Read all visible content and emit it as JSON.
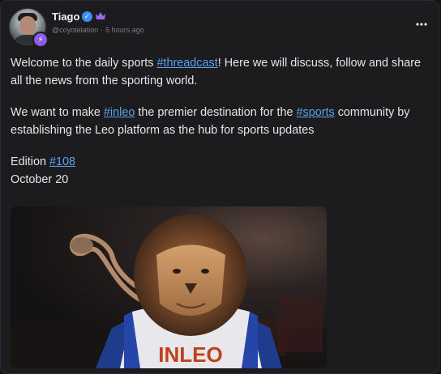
{
  "post": {
    "author_name": "Tiago",
    "handle": "@coyotelation",
    "separator": "·",
    "time_ago": "5 hours ago",
    "more_icon": "more-horizontal-icon",
    "p1": {
      "before": "Welcome to the daily sports ",
      "tag": "#threadcast",
      "after": "! Here we will discuss, follow and share all the news from the sporting world."
    },
    "p2": {
      "before": "We want to make ",
      "tag1": "#inleo",
      "middle": " the premier destination for the ",
      "tag2": "#sports",
      "after": " community by establishing the Leo platform as the hub for sports updates"
    },
    "edition": {
      "label": "Edition ",
      "tag": "#108",
      "date": "October 20"
    },
    "image": {
      "jersey_text": "INLEO",
      "description": "lion in sports jersey"
    }
  },
  "colors": {
    "background": "#1c1b1e",
    "link": "#5aa2ee",
    "verified": "#3e8df6",
    "premium": "#8d5ce8"
  }
}
